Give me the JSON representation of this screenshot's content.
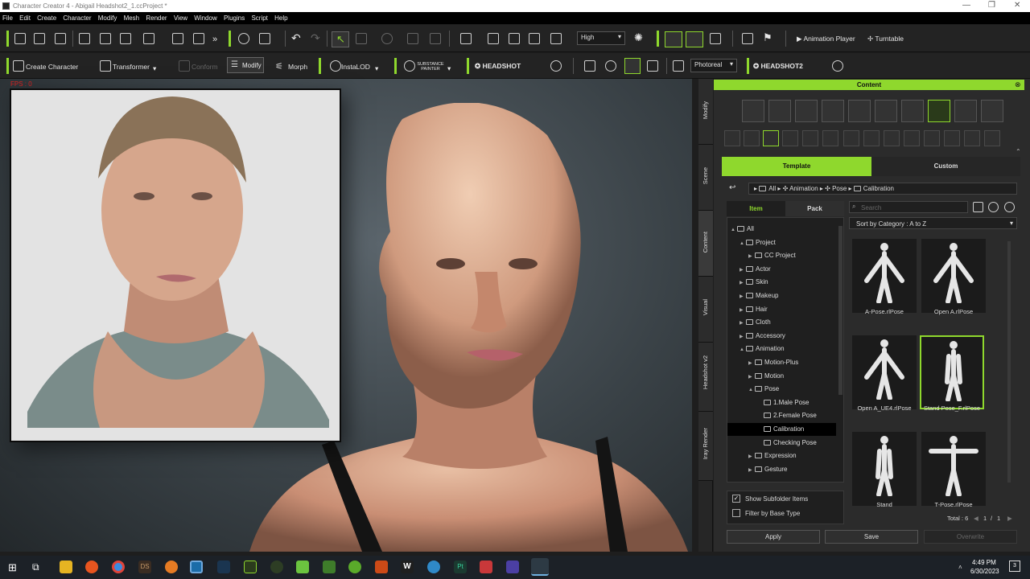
{
  "window": {
    "title": "Character Creator 4 - Abigail Headshot2_1.ccProject *"
  },
  "menu": [
    "File",
    "Edit",
    "Create",
    "Character",
    "Modify",
    "Mesh",
    "Render",
    "View",
    "Window",
    "Plugins",
    "Script",
    "Help"
  ],
  "toolbar1": {
    "quality": "High",
    "animation_player": "Animation Player",
    "turntable": "Turntable"
  },
  "toolbar2": {
    "create_character": "Create Character",
    "transformer": "Transformer",
    "conform": "Conform",
    "modify": "Modify",
    "morph": "Morph",
    "instalod": "InstaLOD",
    "substance": "SUBSTANCE PAINTER",
    "headshot": "HEADSHOT",
    "render_mode": "Photoreal",
    "headshot2": "HEADSHOT2"
  },
  "viewport": {
    "fps": "FPS : 0"
  },
  "side_tabs": [
    "Modify",
    "Scene",
    "Content",
    "Visual",
    "Headshot v2",
    "Iray Render"
  ],
  "panel": {
    "title": "Content",
    "tabs": {
      "template": "Template",
      "custom": "Custom"
    },
    "breadcrumb": [
      "All",
      "Animation",
      "Pose",
      "Calibration"
    ],
    "subtabs": {
      "item": "Item",
      "pack": "Pack"
    },
    "search_placeholder": "Search",
    "sort": "Sort by Category : A to Z",
    "tree": [
      {
        "label": "All",
        "level": 0,
        "arrow": "▲"
      },
      {
        "label": "Project",
        "level": 1,
        "arrow": "▲"
      },
      {
        "label": "CC Project",
        "level": 2,
        "arrow": "▶"
      },
      {
        "label": "Actor",
        "level": 1,
        "arrow": "▶"
      },
      {
        "label": "Skin",
        "level": 1,
        "arrow": "▶"
      },
      {
        "label": "Makeup",
        "level": 1,
        "arrow": "▶"
      },
      {
        "label": "Hair",
        "level": 1,
        "arrow": "▶"
      },
      {
        "label": "Cloth",
        "level": 1,
        "arrow": "▶"
      },
      {
        "label": "Accessory",
        "level": 1,
        "arrow": "▶"
      },
      {
        "label": "Animation",
        "level": 1,
        "arrow": "▲"
      },
      {
        "label": "Motion-Plus",
        "level": 2,
        "arrow": "▶"
      },
      {
        "label": "Motion",
        "level": 2,
        "arrow": "▶"
      },
      {
        "label": "Pose",
        "level": 2,
        "arrow": "▲"
      },
      {
        "label": "1.Male Pose",
        "level": 3,
        "arrow": ""
      },
      {
        "label": "2.Female Pose",
        "level": 3,
        "arrow": ""
      },
      {
        "label": "Calibration",
        "level": 3,
        "arrow": "",
        "selected": true
      },
      {
        "label": "Checking Pose",
        "level": 3,
        "arrow": ""
      },
      {
        "label": "Expression",
        "level": 2,
        "arrow": "▶"
      },
      {
        "label": "Gesture",
        "level": 2,
        "arrow": "▶"
      }
    ],
    "items": [
      {
        "label": "A-Pose.rlPose",
        "pose": "a"
      },
      {
        "label": "Open A.rlPose",
        "pose": "a"
      },
      {
        "label": "Open A_UE4.rlPose",
        "pose": "a"
      },
      {
        "label": "Stand Pose_F.rlPose",
        "pose": "stand",
        "selected": true
      },
      {
        "label": "Stand",
        "pose": "stand"
      },
      {
        "label": "T-Pose.rlPose",
        "pose": "t"
      }
    ],
    "show_subfolder": "Show Subfolder Items",
    "filter_base": "Filter by Base Type",
    "total": "Total : 6",
    "page": "1",
    "page_sep": "/",
    "page_total": "1",
    "apply": "Apply",
    "save": "Save",
    "overwrite": "Overwrite"
  },
  "taskbar": {
    "time": "4:49 PM",
    "date": "6/30/2023",
    "notif": "3"
  },
  "colors": {
    "accent": "#8fd82d",
    "panel": "#2b2b2b",
    "toolbar": "#232323"
  }
}
